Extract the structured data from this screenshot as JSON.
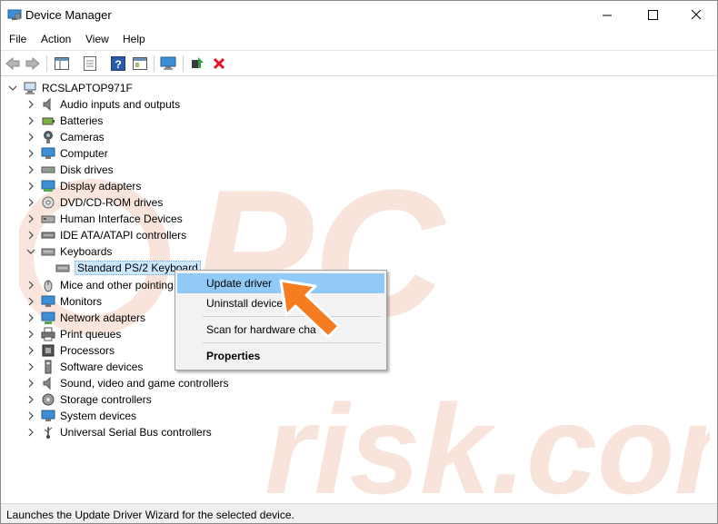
{
  "window": {
    "title": "Device Manager",
    "caption_buttons": [
      "minimize",
      "maximize",
      "close"
    ]
  },
  "menu": [
    "File",
    "Action",
    "View",
    "Help"
  ],
  "toolbar": {
    "buttons": [
      "back-arrow-icon",
      "forward-arrow-icon",
      "properties-icon",
      "show-hide-tree-icon",
      "help-icon",
      "view-icon",
      "monitor-icon",
      "update-driver-icon",
      "uninstall-icon"
    ],
    "accent_red": "#e81123"
  },
  "tree": {
    "root": "RCSLAPTOP971F",
    "categories": [
      "Audio inputs and outputs",
      "Batteries",
      "Cameras",
      "Computer",
      "Disk drives",
      "Display adapters",
      "DVD/CD-ROM drives",
      "Human Interface Devices",
      "IDE ATA/ATAPI controllers",
      "Keyboards",
      "Standard PS/2 Keyboard",
      "Mice and other pointing",
      "Monitors",
      "Network adapters",
      "Print queues",
      "Processors",
      "Software devices",
      "Sound, video and game controllers",
      "Storage controllers",
      "System devices",
      "Universal Serial Bus controllers"
    ]
  },
  "context_menu": {
    "items": [
      "Update driver",
      "Uninstall device",
      "Scan for hardware cha",
      "Properties"
    ],
    "highlight_color": "#91c9f7"
  },
  "status": {
    "text": "Launches the Update Driver Wizard for the selected device."
  },
  "watermark": {
    "text": "PC risk.com",
    "color": "#f5cfc0"
  }
}
